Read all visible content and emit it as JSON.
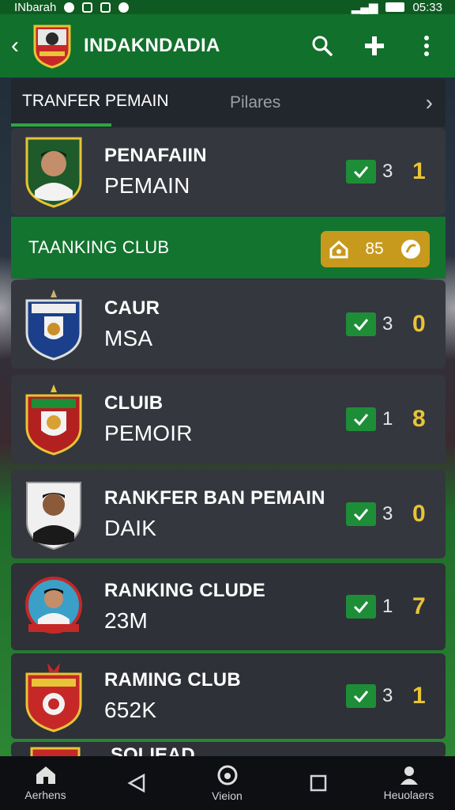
{
  "status": {
    "carrier": "INbarah",
    "time": "05:33"
  },
  "app": {
    "title": "INDAKNDADIA"
  },
  "tabs": {
    "active": "TRANFER PEMAIN",
    "inactive": "Pilares"
  },
  "player_card": {
    "line1": "PENAFAIIN",
    "line2": "PEMAIN",
    "count": "3",
    "score": "1"
  },
  "section": {
    "label": "TAANKING CLUB",
    "badge_value": "85"
  },
  "list": [
    {
      "line1": "CAUR",
      "line2": "MSA",
      "count": "3",
      "score": "0"
    },
    {
      "line1": "CLUIB",
      "line2": "PEMOIR",
      "count": "1",
      "score": "8"
    },
    {
      "line1": "RANKFER BAN PEMAIN",
      "line2": "DAIK",
      "count": "3",
      "score": "0"
    },
    {
      "line1": "RANKING CLUDE",
      "line2": "23M",
      "count": "1",
      "score": "7"
    },
    {
      "line1": "RAMING CLUB",
      "line2": "652K",
      "count": "3",
      "score": "1"
    }
  ],
  "partial_row": {
    "line1": "SOLIEAD"
  },
  "nav": [
    {
      "label": "Aerhens",
      "icon": "home-icon"
    },
    {
      "label": "",
      "icon": "back-triangle-icon"
    },
    {
      "label": "Vieion",
      "icon": "at-icon"
    },
    {
      "label": "",
      "icon": "square-icon"
    },
    {
      "label": "Heuolaers",
      "icon": "person-icon"
    }
  ],
  "colors": {
    "primary_green": "#11702b",
    "accent_gold": "#c79a1d",
    "score_yellow": "#e8c437",
    "card_bg": "#34373e"
  }
}
